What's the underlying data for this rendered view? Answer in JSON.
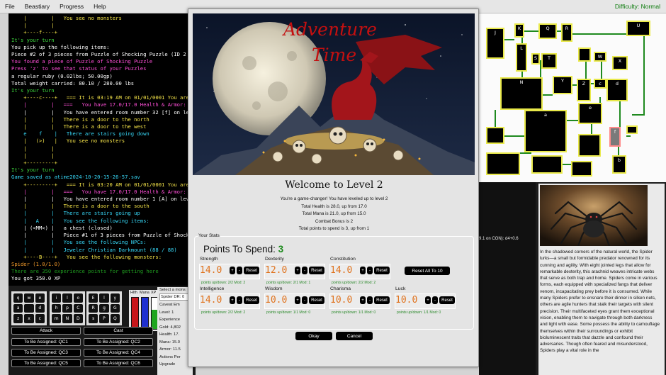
{
  "menu": {
    "items": [
      "File",
      "Beastiary",
      "Progress",
      "Help"
    ],
    "difficulty": "Difficulty: Normal"
  },
  "terminal": {
    "lines": [
      {
        "t": "    |        |   You see no monsters",
        "c": "c-yellow"
      },
      {
        "t": "    |        |",
        "c": "c-yellow"
      },
      {
        "t": "    +----f----+",
        "c": "c-yellow"
      },
      {
        "t": "It's your turn",
        "c": "c-green"
      },
      {
        "t": "You pick up the following items:",
        "c": "c-white"
      },
      {
        "t": "Piece #2 of 3 pieces from Puzzle of Shocking Puzzle (ID 2",
        "c": "c-white"
      },
      {
        "t": "You found a piece of Puzzle of Shocking Puzzle",
        "c": "c-magenta"
      },
      {
        "t": "Press 'z' to see that status of your Puzzles",
        "c": "c-magenta"
      },
      {
        "t": "a regular ruby (0.02lbs; 50.00gp)",
        "c": "c-white"
      },
      {
        "t": "Total weight carried: 80.10 / 280.00 lbs",
        "c": "c-white"
      },
      {
        "t": "It's your turn",
        "c": "c-green"
      },
      {
        "t": "    +----c----+   === It is 03:19 AM on 01/01/0001 You are lev",
        "c": "c-yellow"
      },
      {
        "t": "    |        |   ===   You have 17.0/17.0 Health & Armor: 11.",
        "c": "c-magenta"
      },
      {
        "t": "    |        |   You have entered room number 32 [f] on level",
        "c": "c-white"
      },
      {
        "t": "    |        |   There is a door to the north",
        "c": "c-yellow"
      },
      {
        "t": "    |        |   There is a door to the west",
        "c": "c-yellow"
      },
      {
        "t": "    e    f    |   There are stairs going down",
        "c": "c-cyan"
      },
      {
        "t": "    |   (>)   |   You see no monsters",
        "c": "c-yellow"
      },
      {
        "t": "    |        |",
        "c": "c-yellow"
      },
      {
        "t": "    |        |",
        "c": "c-yellow"
      },
      {
        "t": "    +---------+",
        "c": "c-yellow"
      },
      {
        "t": "It's your turn",
        "c": "c-green"
      },
      {
        "t": "Game saved as atime2024-10-20-15-26-57.sav",
        "c": "c-cyan"
      },
      {
        "t": "    +---------+   === It is 03:20 AM on 01/01/0001 You are lev",
        "c": "c-yellow"
      },
      {
        "t": "    |        |   ===   You have 17.0/17.0 Health & Armor: 11",
        "c": "c-magenta"
      },
      {
        "t": "    |        |   You have entered room number 1 [A] on level",
        "c": "c-white"
      },
      {
        "t": "    |        |   There is a door to the south",
        "c": "c-yellow"
      },
      {
        "t": "    |        |   There are stairs going up",
        "c": "c-cyan"
      },
      {
        "t": "    |   A    |   You see the following items:",
        "c": "c-cyan"
      },
      {
        "t": "    | (<MM<) |   a chest (closed)",
        "c": "c-white"
      },
      {
        "t": "    |        |   Piece #1 of 3 pieces from Puzzle of Shocking",
        "c": "c-white"
      },
      {
        "t": "    |        |   You see the following NPCs:",
        "c": "c-cyan"
      },
      {
        "t": "    |        |   Jeweler Christian Darkmount (88 / 88)",
        "c": "c-cyan"
      },
      {
        "t": "    +----B----+   You see the following monsters:",
        "c": "c-yellow"
      },
      {
        "t": "Spider (1.0/1.0)",
        "c": "c-orange"
      },
      {
        "t": "There are 350 experience points for getting here",
        "c": "c-dkgreen"
      },
      {
        "t": "You got 350.0 XP",
        "c": "c-white"
      }
    ]
  },
  "keypads": [
    [
      "q",
      "w",
      "e",
      "a",
      "",
      "d",
      "z",
      "x",
      "c"
    ],
    [
      "i",
      "l",
      "o",
      "h",
      "p",
      "C",
      "m",
      "N",
      "D"
    ],
    [
      "E",
      "l",
      "y",
      "R",
      "g",
      "G",
      "s",
      "P",
      "Q"
    ]
  ],
  "bars": {
    "labels": [
      "Hlth",
      "Mana",
      "XP"
    ],
    "fractions": [
      1.0,
      1.0,
      0.62
    ],
    "colors": [
      "#c8161b",
      "#1f2fd0",
      "#1fa61f"
    ]
  },
  "actions": [
    "Attack",
    "Cast",
    "To Be Assigned: QC1",
    "To Be Assigned: QC2",
    "To Be Assigned: QC3",
    "To Be Assigned: QC4",
    "To Be Assigned: QC5",
    "To Be Assigned: QC6"
  ],
  "status": {
    "select_label": "Select a mons",
    "select_value": "Spider DR: 0",
    "lines": [
      "Caveat Em",
      "Level: 1",
      "Experience",
      "Gold: 4,802",
      "Health: 17.",
      "Mana: 15.0",
      "Armor: 11.5",
      "Actions Per",
      "Upgrade"
    ]
  },
  "map": {
    "rooms": [
      {
        "l": "J"
      },
      {
        "l": "K"
      },
      {
        "l": "Q"
      },
      {
        "l": "R"
      },
      {
        "l": "U"
      },
      {
        "l": ""
      },
      {
        "l": "L"
      },
      {
        "l": "S"
      },
      {
        "l": "T"
      },
      {
        "l": "W"
      },
      {
        "l": "X"
      },
      {
        "l": "N"
      },
      {
        "l": "Y"
      },
      {
        "l": "Z"
      },
      {
        "l": "c"
      },
      {
        "l": "d"
      },
      {
        "l": "a"
      },
      {
        "l": "e"
      },
      {
        "l": "f"
      },
      {
        "l": ""
      },
      {
        "l": "b"
      },
      {
        "l": ""
      },
      {
        "l": ""
      },
      {
        "l": ""
      },
      {
        "l": ""
      },
      {
        "l": ""
      }
    ]
  },
  "monster_panel": {
    "roll_text": "9.1 on CON): d4+0.6"
  },
  "spider_desc": "In the shadowed corners of the natural world, the Spider lurks—a small but formidable predator renowned for its cunning and agility. With eight jointed legs that allow for remarkable dexterity, this arachnid weaves intricate webs that serve as both trap and home. Spiders come in various forms, each equipped with specialized fangs that deliver venom, incapacitating prey before it is consumed. While many Spiders prefer to ensnare their dinner in silken nets, others are agile hunters that stalk their targets with silent precision. Their multifaceted eyes grant them exceptional vision, enabling them to navigate through both darkness and light with ease. Some possess the ability to camouflage themselves within their surroundings or exhibit bioluminescent traits that dazzle and confound their adversaries. Though often feared and misunderstood, Spiders play a vital role in the",
  "modal": {
    "hero_title_1": "Adventure",
    "hero_title_2": "Time",
    "welcome": "Welcome to Level 2",
    "messages": [
      "You're a game-changer! You have leveled up to level 2",
      "Total Health is 28.0, up from 17.0",
      "Total Mana is 21.0, up from 15.0",
      "Combat Bonus is 2",
      "Total points to spend is 3, up from 1"
    ],
    "your_stats": "Your Stats",
    "points_label": "Points To Spend:",
    "points": "3",
    "stats": [
      {
        "name": "Strength",
        "value": "14.0",
        "note": "points up/down: 2/2 Mod: 2"
      },
      {
        "name": "Dexterity",
        "value": "12.0",
        "note": "points up/down: 2/1 Mod: 1"
      },
      {
        "name": "Constitution",
        "value": "14.0",
        "note": "points up/down: 2/2 Mod: 2"
      },
      {
        "name": "Intelligence",
        "value": "14.0",
        "note": "points up/down: 2/2 Mod: 2"
      },
      {
        "name": "Wisdom",
        "value": "10.0",
        "note": "points up/down: 1/1 Mod: 0"
      },
      {
        "name": "Charisma",
        "value": "10.0",
        "note": "points up/down: 1/1 Mod: 0"
      },
      {
        "name": "Luck",
        "value": "10.0",
        "note": "points up/down: 1/1 Mod: 0"
      }
    ],
    "plus": "+",
    "minus": "-",
    "reset": "Reset",
    "reset_all": "Reset All To 10",
    "okay": "Okay",
    "cancel": "Cancel"
  }
}
